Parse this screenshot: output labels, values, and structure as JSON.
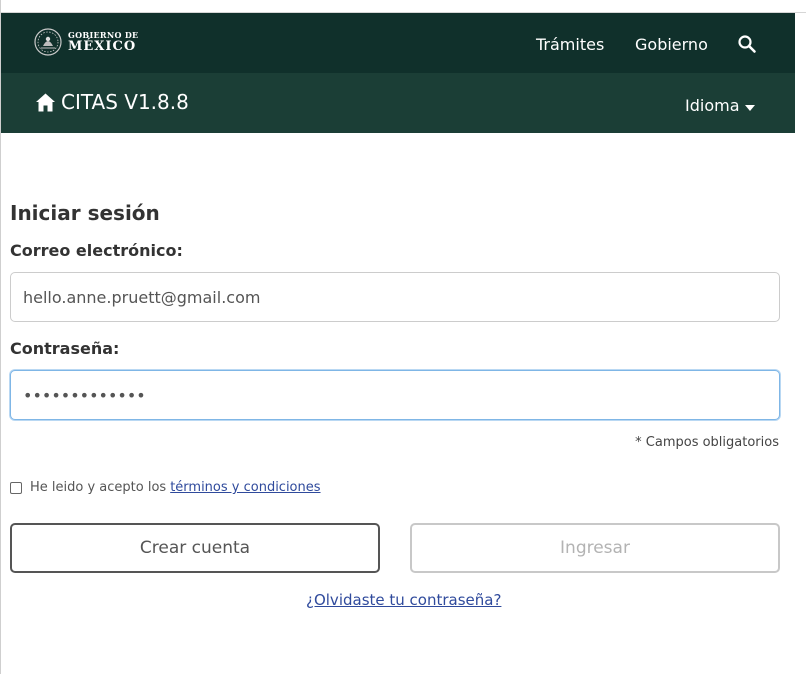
{
  "gov_header": {
    "logo_line1": "GOBIERNO DE",
    "logo_line2": "MÉXICO",
    "logo_icon": "national-seal-icon",
    "nav": [
      "Trámites",
      "Gobierno"
    ],
    "search_icon": "search-icon"
  },
  "app_header": {
    "home_icon": "home-icon",
    "title": "CITAS V1.8.8",
    "language_label": "Idioma",
    "language_icon": "caret-down-icon"
  },
  "login": {
    "heading": "Iniciar sesión",
    "email_label": "Correo electrónico:",
    "email_value": "hello.anne.pruett@gmail.com",
    "password_label": "Contraseña:",
    "password_value": "•••••••••••••",
    "required_note": "* Campos obligatorios",
    "terms_text": "He leido y acepto los",
    "terms_link": "términos y condiciones",
    "terms_checked": false,
    "create_account_label": "Crear cuenta",
    "login_label": "Ingresar",
    "forgot_password_label": "¿Olvidaste tu contraseña?"
  },
  "colors": {
    "gov_bar": "#10302b",
    "app_bar": "#1b3e36",
    "link": "#2f4a9c",
    "focus_border": "#7fb6e6"
  }
}
